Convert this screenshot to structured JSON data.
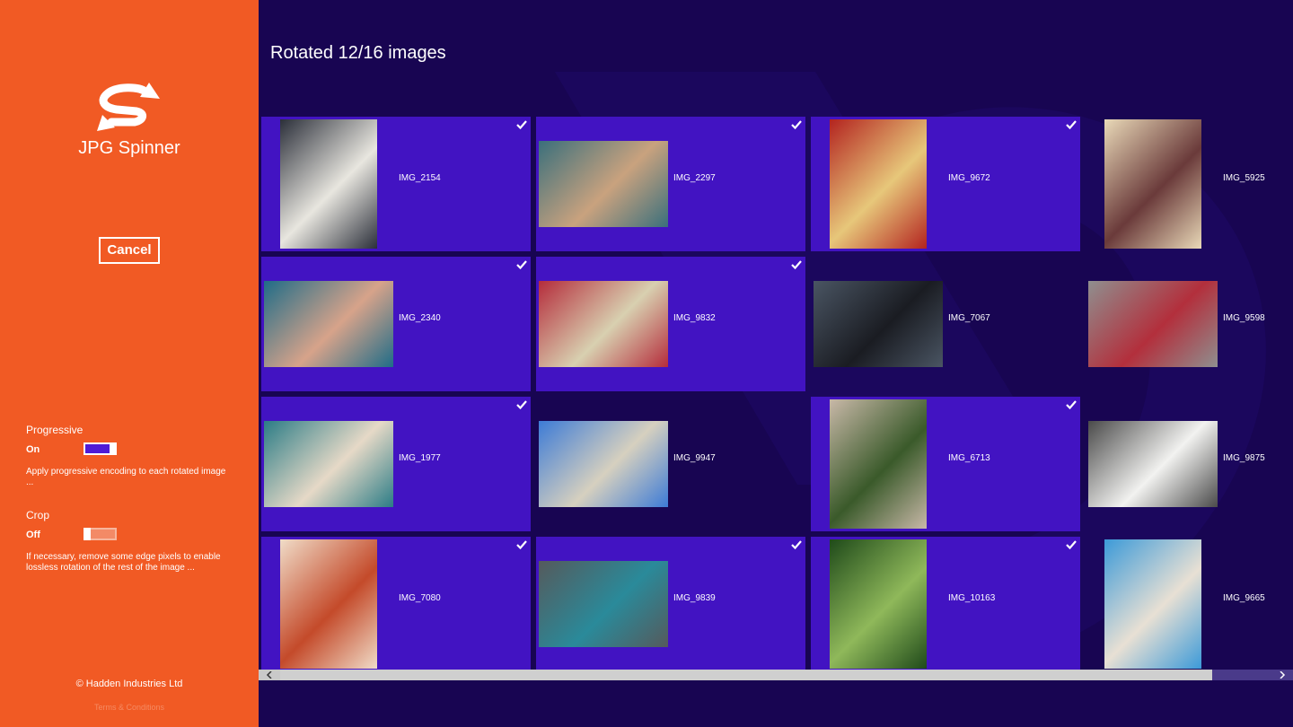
{
  "sidebar": {
    "app_title": "JPG Spinner",
    "cancel_label": "Cancel",
    "progressive": {
      "label": "Progressive",
      "state": "On",
      "description": "Apply progressive encoding to each rotated image ..."
    },
    "crop": {
      "label": "Crop",
      "state": "Off",
      "description": "If necessary, remove some edge pixels to enable lossless rotation of the rest of the image ..."
    },
    "copyright": "© Hadden Industries Ltd",
    "terms": "Terms & Conditions"
  },
  "main": {
    "status": "Rotated 12/16 images",
    "images": [
      {
        "name": "IMG_2154",
        "selected": true,
        "orientation": "portrait",
        "colors": [
          "#2b2f3a",
          "#e8e6df"
        ]
      },
      {
        "name": "IMG_2297",
        "selected": true,
        "orientation": "landscape",
        "colors": [
          "#3a6f7c",
          "#c9a27e"
        ]
      },
      {
        "name": "IMG_9672",
        "selected": true,
        "orientation": "portrait",
        "colors": [
          "#b3231f",
          "#e7c77a"
        ]
      },
      {
        "name": "IMG_5925",
        "selected": false,
        "orientation": "portrait",
        "colors": [
          "#e9d9b8",
          "#6a3a3a"
        ]
      },
      {
        "name": "IMG_2340",
        "selected": true,
        "orientation": "landscape",
        "colors": [
          "#1f6c88",
          "#d7a38a"
        ]
      },
      {
        "name": "IMG_9832",
        "selected": true,
        "orientation": "landscape",
        "colors": [
          "#b52c3b",
          "#d8d0b0"
        ]
      },
      {
        "name": "IMG_7067",
        "selected": false,
        "orientation": "landscape",
        "colors": [
          "#4a5563",
          "#1a1c22"
        ]
      },
      {
        "name": "IMG_9598",
        "selected": false,
        "orientation": "landscape",
        "colors": [
          "#8f8f8f",
          "#b32f3c"
        ]
      },
      {
        "name": "IMG_1977",
        "selected": true,
        "orientation": "landscape",
        "colors": [
          "#2b7c86",
          "#e6d9c7"
        ]
      },
      {
        "name": "IMG_9947",
        "selected": false,
        "orientation": "landscape",
        "colors": [
          "#3d7bd6",
          "#d6d0bf"
        ]
      },
      {
        "name": "IMG_6713",
        "selected": true,
        "orientation": "portrait",
        "colors": [
          "#c8b8a8",
          "#3a5a2a"
        ]
      },
      {
        "name": "IMG_9875",
        "selected": false,
        "orientation": "landscape",
        "colors": [
          "#4a4a4a",
          "#f2f2f0"
        ]
      },
      {
        "name": "IMG_7080",
        "selected": true,
        "orientation": "portrait",
        "colors": [
          "#f0dcc8",
          "#c44a2a"
        ]
      },
      {
        "name": "IMG_9839",
        "selected": true,
        "orientation": "landscape",
        "colors": [
          "#555a5c",
          "#2a8a9a"
        ]
      },
      {
        "name": "IMG_10163",
        "selected": true,
        "orientation": "portrait",
        "colors": [
          "#1f4a1a",
          "#8fb85a"
        ]
      },
      {
        "name": "IMG_9665",
        "selected": false,
        "orientation": "portrait",
        "colors": [
          "#3c9ad8",
          "#e8e0d4"
        ]
      }
    ]
  },
  "theme": {
    "sidebar_bg": "#f15a24",
    "main_bg": "#180552",
    "tile_selected": "#4213c2",
    "toggle_on": "#4f1bd6"
  },
  "icons": {
    "logo": "refresh-s-logo-icon",
    "check": "checkmark-icon",
    "scroll_left": "chevron-left-icon",
    "scroll_right": "chevron-right-icon"
  }
}
